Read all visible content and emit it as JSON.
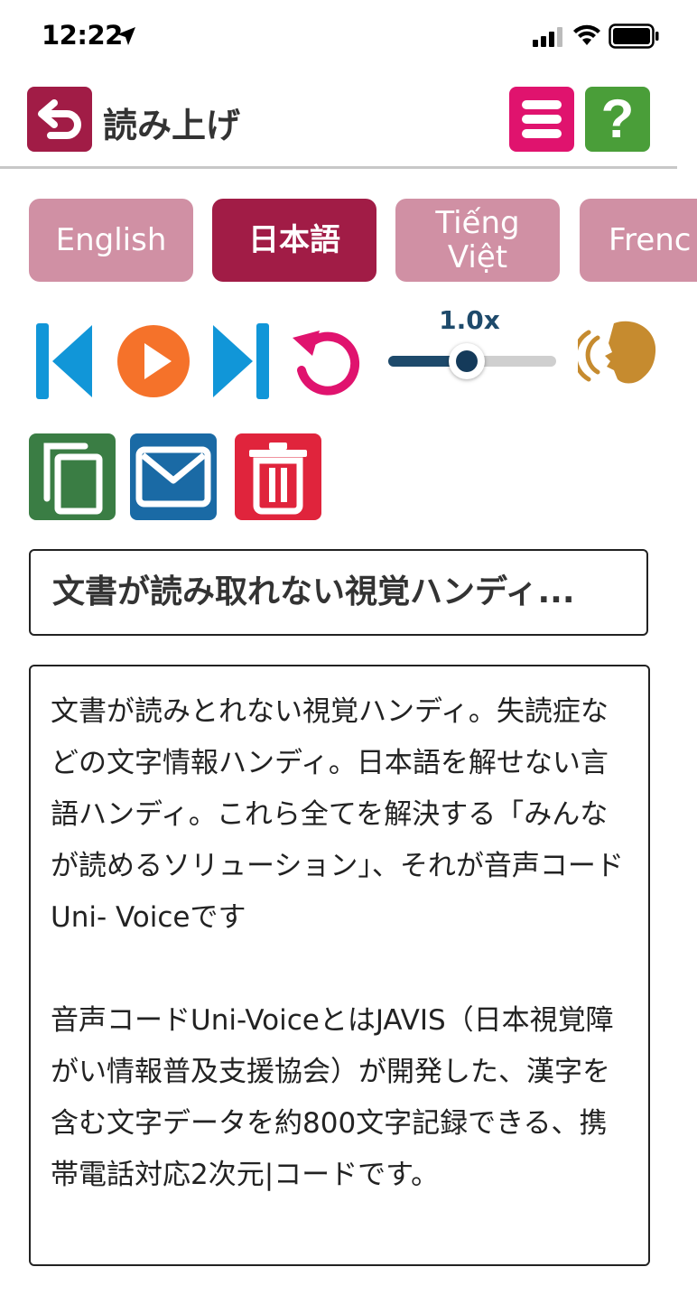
{
  "status_bar": {
    "time": "12:22",
    "icons": [
      "location-arrow-icon",
      "signal-icon",
      "wifi-icon",
      "battery-icon"
    ]
  },
  "header": {
    "title": "読み上げ",
    "back_icon": "back-arrow-icon",
    "menu_icon": "hamburger-menu-icon",
    "help_label": "?"
  },
  "languages": [
    {
      "label": "English",
      "active": false
    },
    {
      "label": "日本語",
      "active": true
    },
    {
      "label": "Tiếng\nViệt",
      "active": false
    },
    {
      "label": "Frenc",
      "active": false
    }
  ],
  "player": {
    "speed_label": "1.0x",
    "speed_fraction": 0.47,
    "controls": [
      "skip-back-icon",
      "play-icon",
      "skip-forward-icon",
      "replay-icon",
      "speaking-head-icon"
    ]
  },
  "actions": [
    {
      "name": "copy-button",
      "icon": "copy-icon",
      "color": "#3a7d44"
    },
    {
      "name": "mail-button",
      "icon": "mail-icon",
      "color": "#1a6aa5"
    },
    {
      "name": "delete-button",
      "icon": "trash-icon",
      "color": "#e0243c"
    }
  ],
  "document": {
    "title": "文書が読み取れない視覚ハンディ...",
    "body": "文書が読みとれない視覚ハンディ。失読症などの文字情報ハンディ。日本語を解せない言語ハンディ。これら全てを解決する「みんなが読めるソリューション」、それが音声コードUni- Voiceです\n\n音声コードUni-VoiceとはJAVIS（日本視覚障がい情報普及支援協会）が開発した、漢字を含む文字データを約800文字記録できる、携帯電話対応2次元|コードです。"
  },
  "colors": {
    "brand": "#a11c46",
    "tab_inactive": "#d090a4",
    "menu": "#e0136e",
    "help": "#4a9e39",
    "nav_blue": "#1196d8",
    "play_orange": "#f5722a",
    "replay_pink": "#e0136e",
    "speaker_gold": "#c68b2f"
  }
}
